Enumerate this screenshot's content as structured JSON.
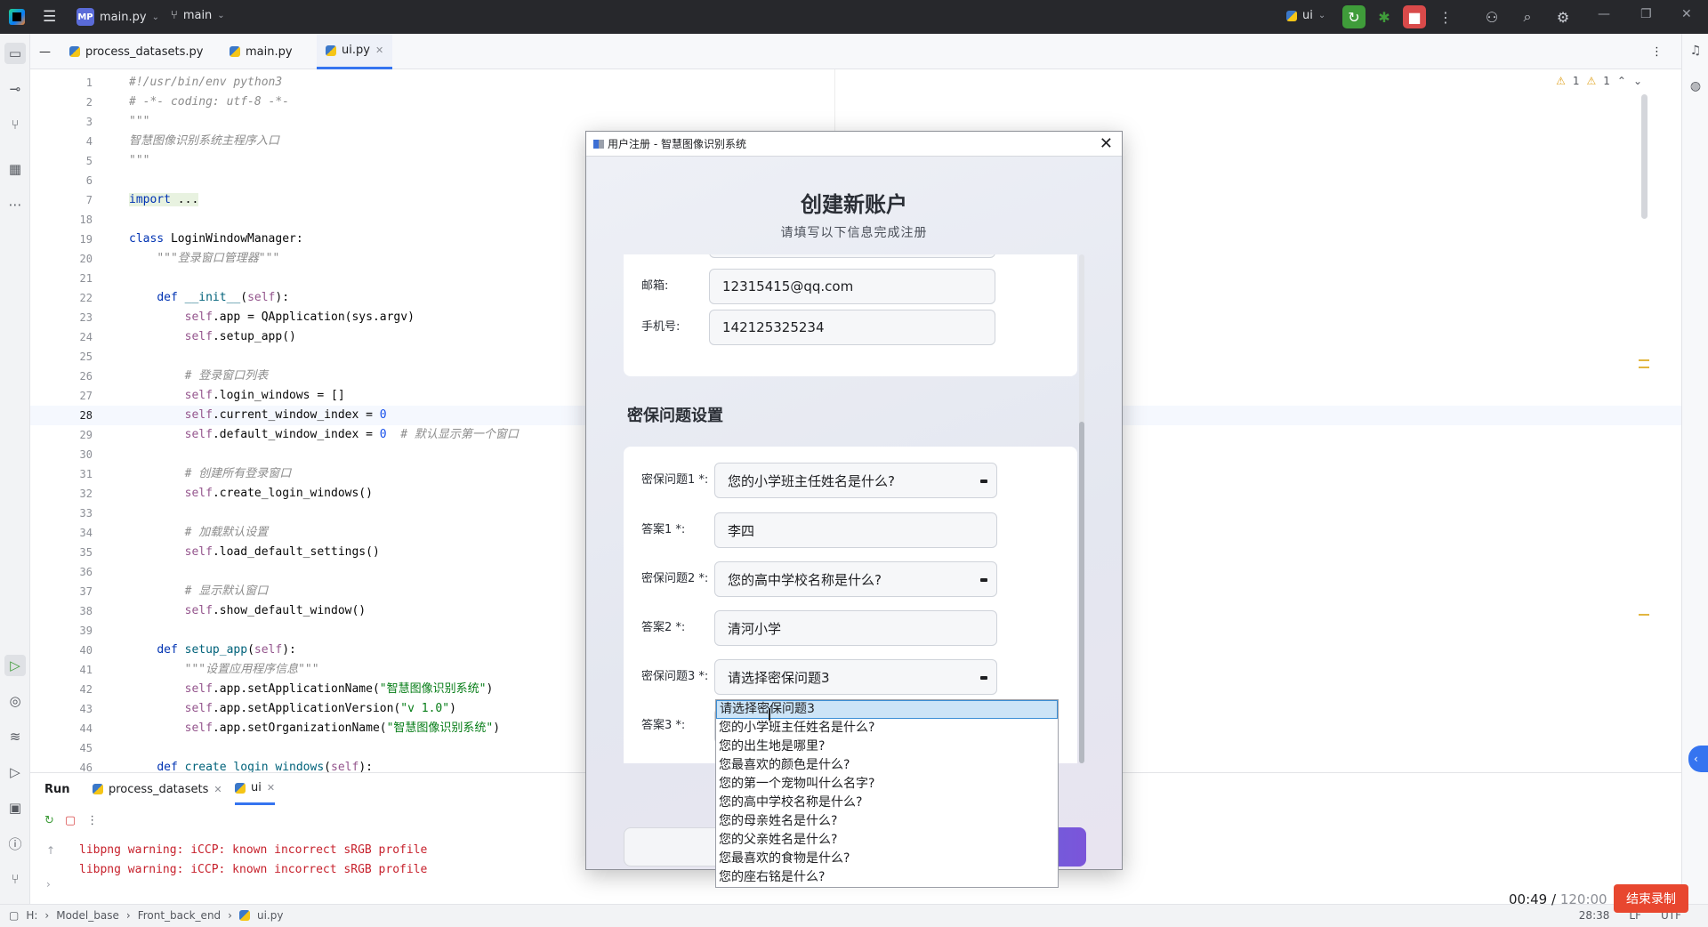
{
  "titlebar": {
    "project_badge": "MP",
    "project_name": "main.py",
    "branch": "main",
    "run_config": "ui"
  },
  "editor_tabs": [
    {
      "label": "process_datasets.py"
    },
    {
      "label": "main.py"
    },
    {
      "label": "ui.py"
    }
  ],
  "inspections": {
    "warnings": "1",
    "weak_warnings": "1"
  },
  "code_lines": [
    {
      "n": "1",
      "html": "<span class=\"cm\">#!/usr/bin/env python3</span>"
    },
    {
      "n": "2",
      "html": "<span class=\"cm\"># -*- coding: utf-8 -*-</span>"
    },
    {
      "n": "3",
      "html": "<span class=\"cm\">\"\"\"</span>"
    },
    {
      "n": "4",
      "html": "<span class=\"cm\">智慧图像识别系统主程序入口</span>"
    },
    {
      "n": "5",
      "html": "<span class=\"cm\">\"\"\"</span>"
    },
    {
      "n": "6",
      "html": ""
    },
    {
      "n": "7",
      "html": "<span class=\"fold-bg\"><span class=\"kw\">import</span> ...</span>"
    },
    {
      "n": "18",
      "html": ""
    },
    {
      "n": "19",
      "html": "<span class=\"kw\">class</span> LoginWindowManager:"
    },
    {
      "n": "20",
      "html": "    <span class=\"cm\">\"\"\"登录窗口管理器\"\"\"</span>"
    },
    {
      "n": "21",
      "html": ""
    },
    {
      "n": "22",
      "html": "    <span class=\"kw\">def</span> <span class=\"fn\">__init__</span>(<span class=\"slf\">self</span>):"
    },
    {
      "n": "23",
      "html": "        <span class=\"slf\">self</span>.app = QApplication(sys.argv)"
    },
    {
      "n": "24",
      "html": "        <span class=\"slf\">self</span>.setup_app()"
    },
    {
      "n": "25",
      "html": ""
    },
    {
      "n": "26",
      "html": "        <span class=\"cm\"># 登录窗口列表</span>"
    },
    {
      "n": "27",
      "html": "        <span class=\"slf\">self</span>.login_windows = []"
    },
    {
      "n": "28",
      "html": "        <span class=\"slf\">self</span>.current_window_index = <span class=\"num\">0</span>",
      "current": true
    },
    {
      "n": "29",
      "html": "        <span class=\"slf\">self</span>.default_window_index = <span class=\"num\">0</span>  <span class=\"cm\"># 默认显示第一个窗口</span>"
    },
    {
      "n": "30",
      "html": ""
    },
    {
      "n": "31",
      "html": "        <span class=\"cm\"># 创建所有登录窗口</span>"
    },
    {
      "n": "32",
      "html": "        <span class=\"slf\">self</span>.create_login_windows()"
    },
    {
      "n": "33",
      "html": ""
    },
    {
      "n": "34",
      "html": "        <span class=\"cm\"># 加载默认设置</span>"
    },
    {
      "n": "35",
      "html": "        <span class=\"slf\">self</span>.load_default_settings()"
    },
    {
      "n": "36",
      "html": ""
    },
    {
      "n": "37",
      "html": "        <span class=\"cm\"># 显示默认窗口</span>"
    },
    {
      "n": "38",
      "html": "        <span class=\"slf\">self</span>.show_default_window()"
    },
    {
      "n": "39",
      "html": ""
    },
    {
      "n": "40",
      "html": "    <span class=\"kw\">def</span> <span class=\"fn\">setup_app</span>(<span class=\"slf\">self</span>):"
    },
    {
      "n": "41",
      "html": "        <span class=\"cm\">\"\"\"设置应用程序信息\"\"\"</span>"
    },
    {
      "n": "42",
      "html": "        <span class=\"slf\">self</span>.app.setApplicationName(<span class=\"str\">\"智慧图像识别系统\"</span>)"
    },
    {
      "n": "43",
      "html": "        <span class=\"slf\">self</span>.app.setApplicationVersion(<span class=\"str\">\"v 1.0\"</span>)"
    },
    {
      "n": "44",
      "html": "        <span class=\"slf\">self</span>.app.setOrganizationName(<span class=\"str\">\"智慧图像识别系统\"</span>)"
    },
    {
      "n": "45",
      "html": ""
    },
    {
      "n": "46",
      "html": "    <span class=\"kw\">def</span> <span class=\"fn\">create_login_windows</span>(<span class=\"slf\">self</span>):"
    }
  ],
  "run_panel": {
    "title": "Run",
    "tabs": [
      {
        "label": "process_datasets"
      },
      {
        "label": "ui"
      }
    ],
    "console": [
      "libpng warning: iCCP: known incorrect sRGB profile",
      "libpng warning: iCCP: known incorrect sRGB profile"
    ]
  },
  "statusbar": {
    "crumbs": [
      "H:",
      "Model_base",
      "Front_back_end",
      "ui.py"
    ],
    "position": "28:38",
    "line_sep": "LF",
    "encoding": "UTF"
  },
  "recording": {
    "elapsed": "00:49",
    "total": "120:00",
    "stop_label": "结束录制"
  },
  "dialog": {
    "title": "用户注册 - 智慧图像识别系统",
    "heading": "创建新账户",
    "subheading": "请填写以下信息完成注册",
    "email_label": "邮箱:",
    "email_value": "12315415@qq.com",
    "phone_label": "手机号:",
    "phone_value": "142125325234",
    "security_title": "密保问题设置",
    "q1_label": "密保问题1 *:",
    "q1_value": "您的小学班主任姓名是什么?",
    "a1_label": "答案1 *:",
    "a1_value": "李四",
    "q2_label": "密保问题2 *:",
    "q2_value": "您的高中学校名称是什么?",
    "a2_label": "答案2 *:",
    "a2_value": "清河小学",
    "q3_label": "密保问题3 *:",
    "q3_value": "请选择密保问题3",
    "a3_label": "答案3 *:"
  },
  "dropdown_options": [
    "请选择密保问题3",
    "您的小学班主任姓名是什么?",
    "您的出生地是哪里?",
    "您最喜欢的颜色是什么?",
    "您的第一个宠物叫什么名字?",
    "您的高中学校名称是什么?",
    "您的母亲姓名是什么?",
    "您的父亲姓名是什么?",
    "您最喜欢的食物是什么?",
    "您的座右铭是什么?"
  ]
}
